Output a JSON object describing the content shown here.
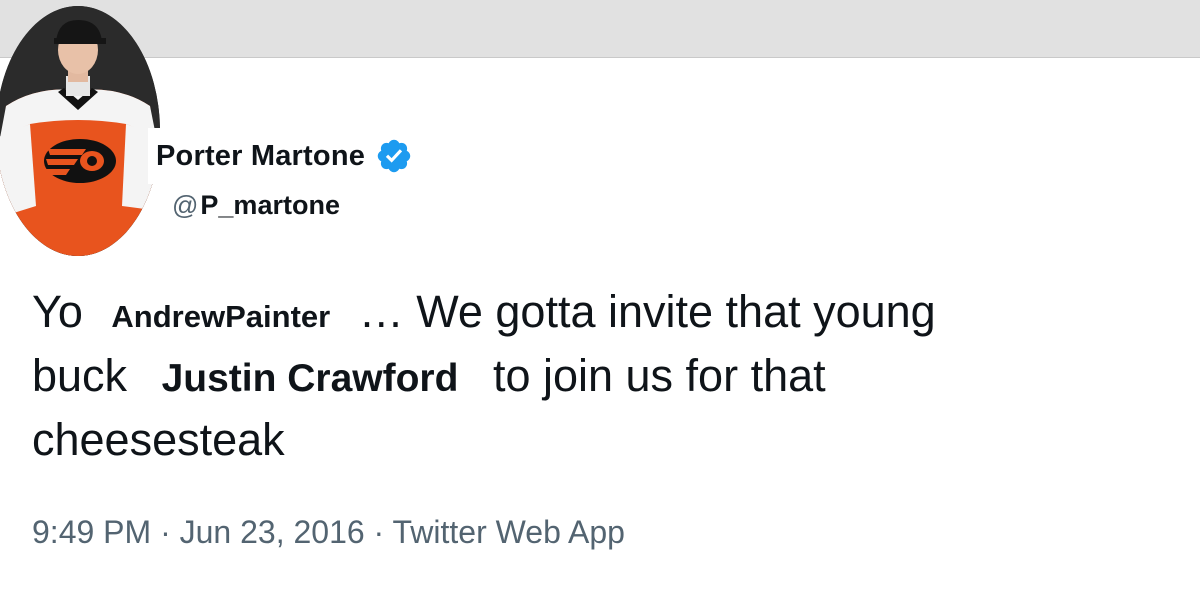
{
  "author": {
    "display_name": "Porter Martone",
    "handle_at": "@",
    "handle": "P_martone",
    "verified": true,
    "avatar_icon": "hockey-player-avatar-icon",
    "verified_icon": "verified-badge-icon"
  },
  "tweet": {
    "line1_before": "Yo ",
    "mention1": "AndrewPainter",
    "line1_after": " … We gotta invite that young",
    "line2_before": "buck ",
    "mention2": "Justin Crawford",
    "line2_after": " to join us for that",
    "line3": "cheesesteak"
  },
  "meta": {
    "text": "9:49 PM · Jun 23, 2016 · Twitter Web App"
  },
  "colors": {
    "verified_blue": "#1d9bf0",
    "text_primary": "#0f1419",
    "text_secondary": "#536471",
    "top_bar": "#e1e1e1",
    "jersey_orange": "#e8541e"
  }
}
